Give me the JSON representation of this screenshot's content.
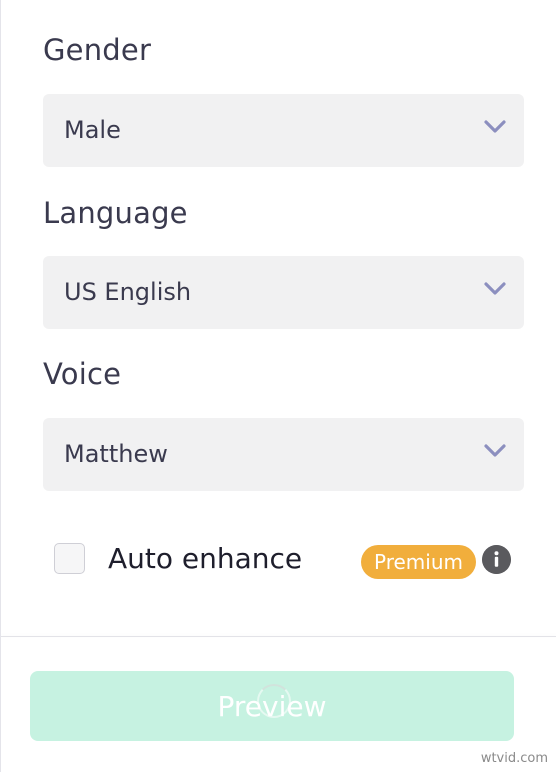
{
  "gender": {
    "label": "Gender",
    "selected": "Male"
  },
  "language": {
    "label": "Language",
    "selected": "US English"
  },
  "voice": {
    "label": "Voice",
    "selected": "Matthew"
  },
  "auto_enhance": {
    "label": "Auto enhance",
    "checked": false,
    "badge": "Premium",
    "info_icon": "info-icon"
  },
  "footer": {
    "preview_label": "Preview"
  },
  "watermark": "wtvid.com",
  "colors": {
    "select_bg": "#f1f1f2",
    "chevron": "#8c8fbf",
    "premium_badge": "#f1ae3c",
    "preview_button": "#c6f2e1",
    "info_icon": "#5a5a5e"
  }
}
